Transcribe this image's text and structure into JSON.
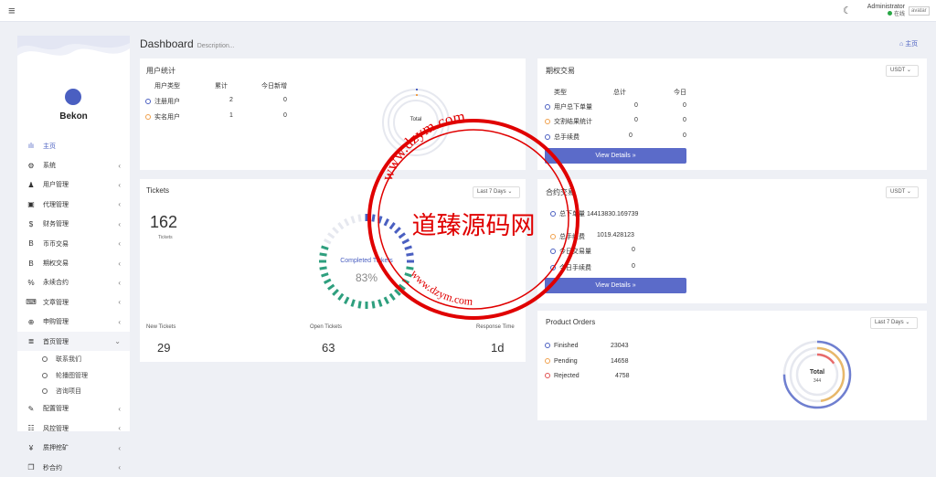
{
  "topbar": {
    "admin_name": "Administrator",
    "status": "在线",
    "avatar_alt": "avatar"
  },
  "sidebar": {
    "brand": "Bekon",
    "items": [
      {
        "icon": "chart-icon",
        "glyph": "ılı",
        "label": "主页",
        "arrow": "",
        "active": true
      },
      {
        "icon": "gear-icon",
        "glyph": "⚙",
        "label": "系统",
        "arrow": "‹"
      },
      {
        "icon": "user-icon",
        "glyph": "♟",
        "label": "用户管理",
        "arrow": "‹"
      },
      {
        "icon": "id-card-icon",
        "glyph": "▣",
        "label": "代理管理",
        "arrow": "‹"
      },
      {
        "icon": "dollar-icon",
        "glyph": "$",
        "label": "财务管理",
        "arrow": "‹"
      },
      {
        "icon": "bitcoin-icon",
        "glyph": "B",
        "label": "币币交易",
        "arrow": "‹"
      },
      {
        "icon": "bitcoin-icon",
        "glyph": "B",
        "label": "期权交易",
        "arrow": "‹"
      },
      {
        "icon": "percent-icon",
        "glyph": "%",
        "label": "永续合约",
        "arrow": "‹"
      },
      {
        "icon": "keyboard-icon",
        "glyph": "⌨",
        "label": "文章管理",
        "arrow": "‹"
      },
      {
        "icon": "globe-icon",
        "glyph": "⊕",
        "label": "申购管理",
        "arrow": "‹"
      },
      {
        "icon": "list-icon",
        "glyph": "≣",
        "label": "首页管理",
        "arrow": "⌄",
        "open": true
      }
    ],
    "subitems": [
      "联系我们",
      "轮播图管理",
      "咨询项目"
    ],
    "items2": [
      {
        "icon": "wrench-icon",
        "glyph": "✎",
        "label": "配置管理",
        "arrow": "‹"
      },
      {
        "icon": "table-icon",
        "glyph": "☷",
        "label": "风控管理",
        "arrow": "‹"
      },
      {
        "icon": "yen-icon",
        "glyph": "¥",
        "label": "质押挖矿",
        "arrow": "‹"
      },
      {
        "icon": "copy-icon",
        "glyph": "❐",
        "label": "秒合约",
        "arrow": "‹"
      }
    ]
  },
  "page": {
    "title": "Dashboard",
    "description": "Description...",
    "breadcrumb": "主页"
  },
  "user_stats": {
    "title": "用户统计",
    "headers": [
      "用户类型",
      "累计",
      "今日新增"
    ],
    "rows": [
      {
        "label": "注册用户",
        "total": "2",
        "today": "0",
        "color": "#4a5fc1"
      },
      {
        "label": "实名用户",
        "total": "1",
        "today": "0",
        "color": "#f0a04b"
      }
    ],
    "donut_label": "Total"
  },
  "options": {
    "title": "期权交易",
    "currency": "USDT",
    "headers": [
      "类型",
      "总计",
      "今日"
    ],
    "rows": [
      {
        "label": "用户总下单量",
        "total": "0",
        "today": "0",
        "color": "#4a5fc1"
      },
      {
        "label": "交割结果统计",
        "total": "0",
        "today": "0",
        "color": "#f0a04b"
      },
      {
        "label": "总手续费",
        "total": "0",
        "today": "0",
        "color": "#4a5fc1"
      }
    ],
    "button": "View Details »"
  },
  "tickets": {
    "title": "Tickets",
    "range": "Last 7 Days",
    "count": "162",
    "count_label": "Tickets",
    "gauge_label": "Completed Tickets",
    "gauge_value": "83%",
    "gauge_fraction": 0.83,
    "stats": [
      {
        "label": "New Tickets",
        "value": "29"
      },
      {
        "label": "Open Tickets",
        "value": "63"
      },
      {
        "label": "Response Time",
        "value": "1d"
      }
    ]
  },
  "contracts": {
    "title": "合约交易",
    "currency": "USDT",
    "rows": [
      {
        "label": "总下单量",
        "value": "14413830.169739",
        "color": "#4a5fc1"
      },
      {
        "label": "总手续费",
        "value": "1019.428123",
        "color": "#f0a04b"
      },
      {
        "label": "今日交易量",
        "value": "0",
        "color": "#4a5fc1"
      },
      {
        "label": "今日手续费",
        "value": "0",
        "color": "#4a5fc1"
      }
    ],
    "button": "View Details »"
  },
  "orders": {
    "title": "Product Orders",
    "range": "Last 7 Days",
    "rows": [
      {
        "label": "Finished",
        "value": "23043",
        "color": "#4a5fc1"
      },
      {
        "label": "Pending",
        "value": "14658",
        "color": "#f0a04b"
      },
      {
        "label": "Rejected",
        "value": "4758",
        "color": "#e05050"
      }
    ],
    "donut_label": "Total",
    "donut_value": "344"
  },
  "watermark": {
    "text": "道臻源码网",
    "url": "www.dzym.com"
  },
  "colors": {
    "primary": "#5b6bc9",
    "orange": "#f0a04b",
    "red": "#e05050",
    "green": "#2e9f7e",
    "watermark": "#e00000"
  }
}
